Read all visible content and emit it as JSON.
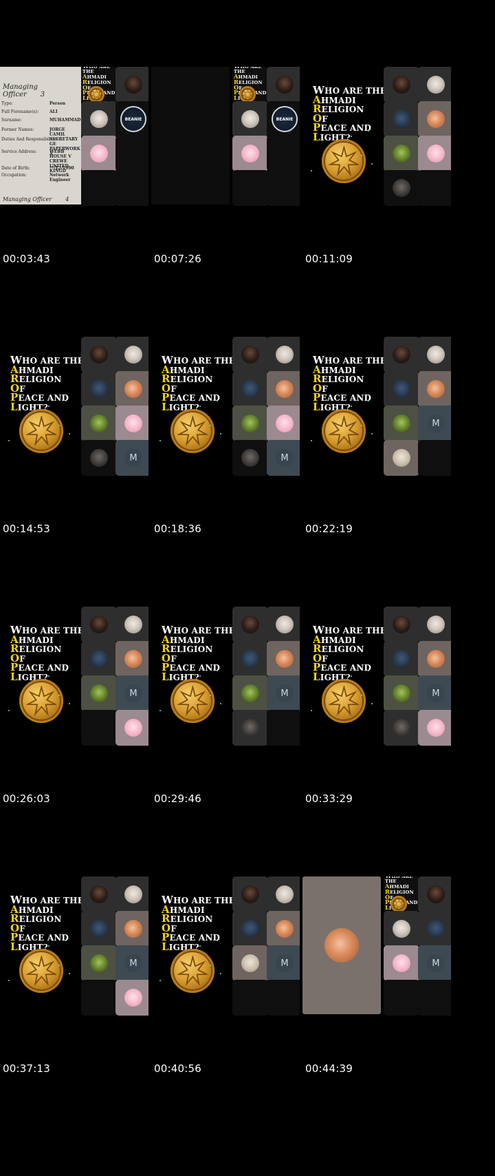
{
  "thumbnails": [
    {
      "timestamp": "00:03:43"
    },
    {
      "timestamp": "00:07:26"
    },
    {
      "timestamp": "00:11:09"
    },
    {
      "timestamp": "00:14:53"
    },
    {
      "timestamp": "00:18:36"
    },
    {
      "timestamp": "00:22:19"
    },
    {
      "timestamp": "00:26:03"
    },
    {
      "timestamp": "00:29:46"
    },
    {
      "timestamp": "00:33:29"
    },
    {
      "timestamp": "00:37:13"
    },
    {
      "timestamp": "00:40:56"
    },
    {
      "timestamp": "00:44:39"
    }
  ],
  "title_lines": [
    {
      "first": "W",
      "rest": "ho are the",
      "highlight": false
    },
    {
      "first": "A",
      "rest": "hmadi",
      "highlight": true
    },
    {
      "first": "R",
      "rest": "eligion",
      "highlight": true
    },
    {
      "first": "O",
      "rest": "f",
      "highlight": true
    },
    {
      "first": "P",
      "rest": "eace and",
      "highlight": true
    },
    {
      "first": "L",
      "rest": "ight?",
      "highlight": true
    }
  ],
  "participant_initial": "M",
  "document": {
    "heading": "Managing Officer",
    "heading_num": "3",
    "footer": "Managing Officer",
    "footer_num": "4",
    "rows": [
      {
        "k": "Type:",
        "v": "Person"
      },
      {
        "k": "Full Forename(s):",
        "v": "ALI"
      },
      {
        "k": "Surname:",
        "v": "MUHAMMAD"
      },
      {
        "k": "Former Names:",
        "v": "JORGE CAMIL"
      },
      {
        "k": "Duties And Responsibilities:",
        "v": "SECRETARY GE PAPERWORK A"
      },
      {
        "k": "Service Address:",
        "v": "WEBB HOUSE V CREWE UNITED KINGD"
      },
      {
        "k": "Date of Birth:",
        "v": "**/12/1990"
      },
      {
        "k": "Occupation:",
        "v": "Network Engineer"
      }
    ]
  },
  "badge_text": "BEANIE",
  "colors": {
    "accent_yellow": "#f2d21b",
    "coin_gold": "#d59a2c",
    "sparkle": "#57f0b0"
  }
}
